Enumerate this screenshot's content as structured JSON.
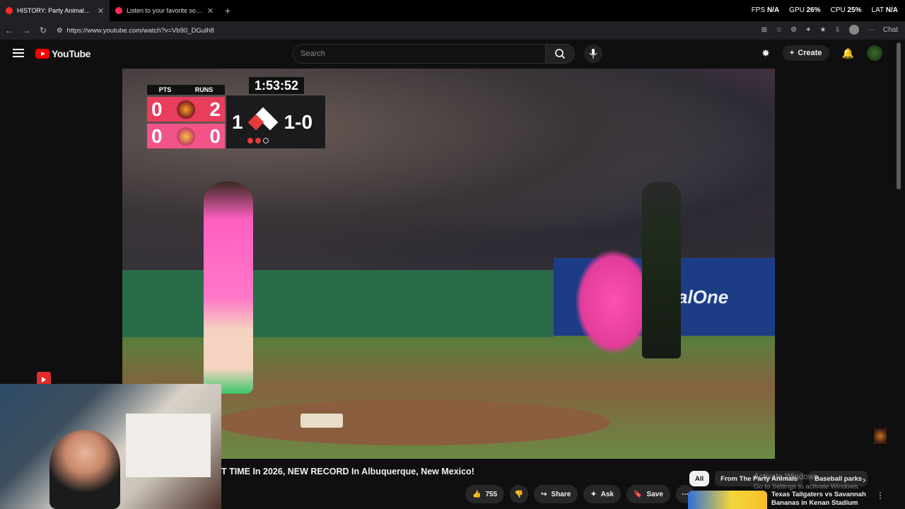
{
  "browser": {
    "tabs": [
      {
        "title": "HISTORY: Party Animals & First...",
        "active": true,
        "icon_color": "#ff2b2b"
      },
      {
        "title": "Listen to your favorite songs and...",
        "active": false,
        "icon_color": "#ff2d55"
      }
    ],
    "new_tab": "+",
    "perf": {
      "fps_label": "FPS",
      "fps_value": "N/A",
      "gpu_label": "GPU",
      "gpu_value": "26%",
      "cpu_label": "CPU",
      "cpu_value": "25%",
      "lat_label": "LAT",
      "lat_value": "N/A"
    },
    "url": "https://www.youtube.com/watch?v=Vb90_DGulh8",
    "chat_label": "Chat"
  },
  "youtube": {
    "logo_text": "YouTube",
    "search_placeholder": "Search",
    "create_label": "Create"
  },
  "scorebug": {
    "pts_label": "PTS",
    "runs_label": "RUNS",
    "clock": "1:53:52",
    "team1_pts": "0",
    "team1_runs": "2",
    "team2_pts": "0",
    "team2_runs": "0",
    "inning": "1",
    "count": "1-0",
    "outs": 2,
    "ad_text": "alOne"
  },
  "video": {
    "title": "T TIME In 2026, NEW RECORD In Albuquerque, New Mexico!",
    "likes": "755",
    "share_label": "Share",
    "ask_label": "Ask",
    "save_label": "Save"
  },
  "chips": [
    "All",
    "From The Party Animals",
    "Baseball parks"
  ],
  "recommendation": {
    "title": "Texas Tailgaters vs Savannah Bananas in Kenan Stadium at..."
  },
  "watermark": {
    "line1": "Activate Windows",
    "line2": "Go to Settings to activate Windows."
  }
}
